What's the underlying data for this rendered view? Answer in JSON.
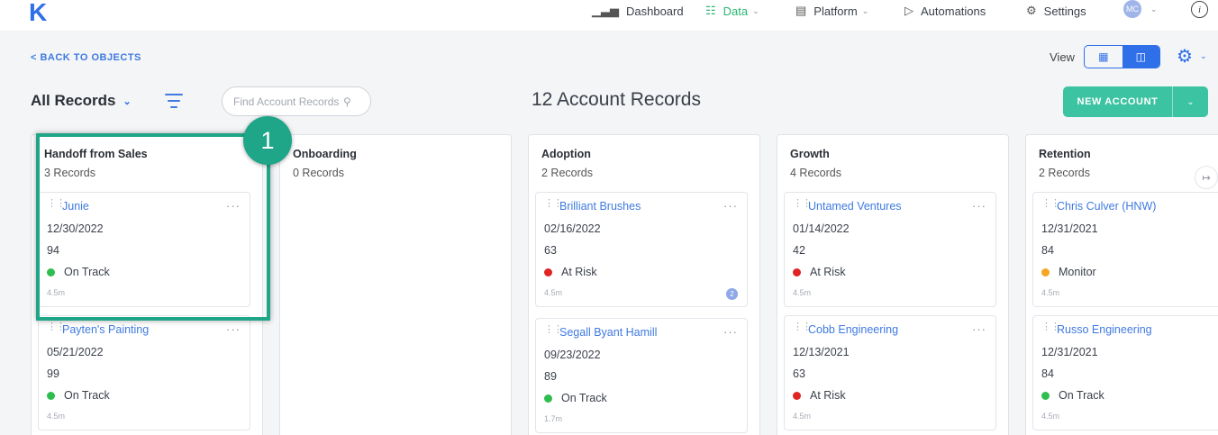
{
  "nav": {
    "logo": "K",
    "items": [
      {
        "label": "Dashboard",
        "icon": "bar-chart-icon",
        "glyph": "▁▃▅"
      },
      {
        "label": "Data",
        "icon": "database-icon",
        "glyph": "☷"
      },
      {
        "label": "Platform",
        "icon": "calendar-icon",
        "glyph": "▤"
      },
      {
        "label": "Automations",
        "icon": "play-icon",
        "glyph": "▷"
      },
      {
        "label": "Settings",
        "icon": "gear-icon",
        "glyph": "⚙"
      }
    ],
    "avatar_initials": "MC",
    "info_glyph": "i"
  },
  "toolbar": {
    "back_label": "< BACK TO OBJECTS",
    "view_label": "View",
    "all_records_label": "All Records",
    "search_placeholder": "Find Account Records",
    "records_title": "12 Account Records",
    "new_account_label": "NEW ACCOUNT"
  },
  "callout": {
    "number": "1"
  },
  "columns": [
    {
      "title": "Handoff from Sales",
      "count": "3 Records",
      "cards": [
        {
          "name": "Junie",
          "date": "12/30/2022",
          "score": "94",
          "status": "On Track",
          "status_color": "#2ebd4e",
          "age": "4.5m",
          "badge": ""
        },
        {
          "name": "Payten's Painting",
          "date": "05/21/2022",
          "score": "99",
          "status": "On Track",
          "status_color": "#2ebd4e",
          "age": "4.5m",
          "badge": ""
        }
      ]
    },
    {
      "title": "Onboarding",
      "count": "0 Records",
      "cards": []
    },
    {
      "title": "Adoption",
      "count": "2 Records",
      "cards": [
        {
          "name": "Brilliant Brushes",
          "date": "02/16/2022",
          "score": "63",
          "status": "At Risk",
          "status_color": "#e02424",
          "age": "4.5m",
          "badge": "2"
        },
        {
          "name": "Segall Byant Hamill",
          "date": "09/23/2022",
          "score": "89",
          "status": "On Track",
          "status_color": "#2ebd4e",
          "age": "1.7m",
          "badge": ""
        }
      ]
    },
    {
      "title": "Growth",
      "count": "4 Records",
      "cards": [
        {
          "name": "Untamed Ventures",
          "date": "01/14/2022",
          "score": "42",
          "status": "At Risk",
          "status_color": "#e02424",
          "age": "4.5m",
          "badge": ""
        },
        {
          "name": "Cobb Engineering",
          "date": "12/13/2021",
          "score": "63",
          "status": "At Risk",
          "status_color": "#e02424",
          "age": "4.5m",
          "badge": ""
        }
      ]
    },
    {
      "title": "Retention",
      "count": "2 Records",
      "cards": [
        {
          "name": "Chris Culver (HNW)",
          "date": "12/31/2021",
          "score": "84",
          "status": "Monitor",
          "status_color": "#f5a623",
          "age": "4.5m",
          "badge": ""
        },
        {
          "name": "Russo Engineering",
          "date": "12/31/2021",
          "score": "84",
          "status": "On Track",
          "status_color": "#2ebd4e",
          "age": "4.5m",
          "badge": ""
        }
      ]
    }
  ]
}
